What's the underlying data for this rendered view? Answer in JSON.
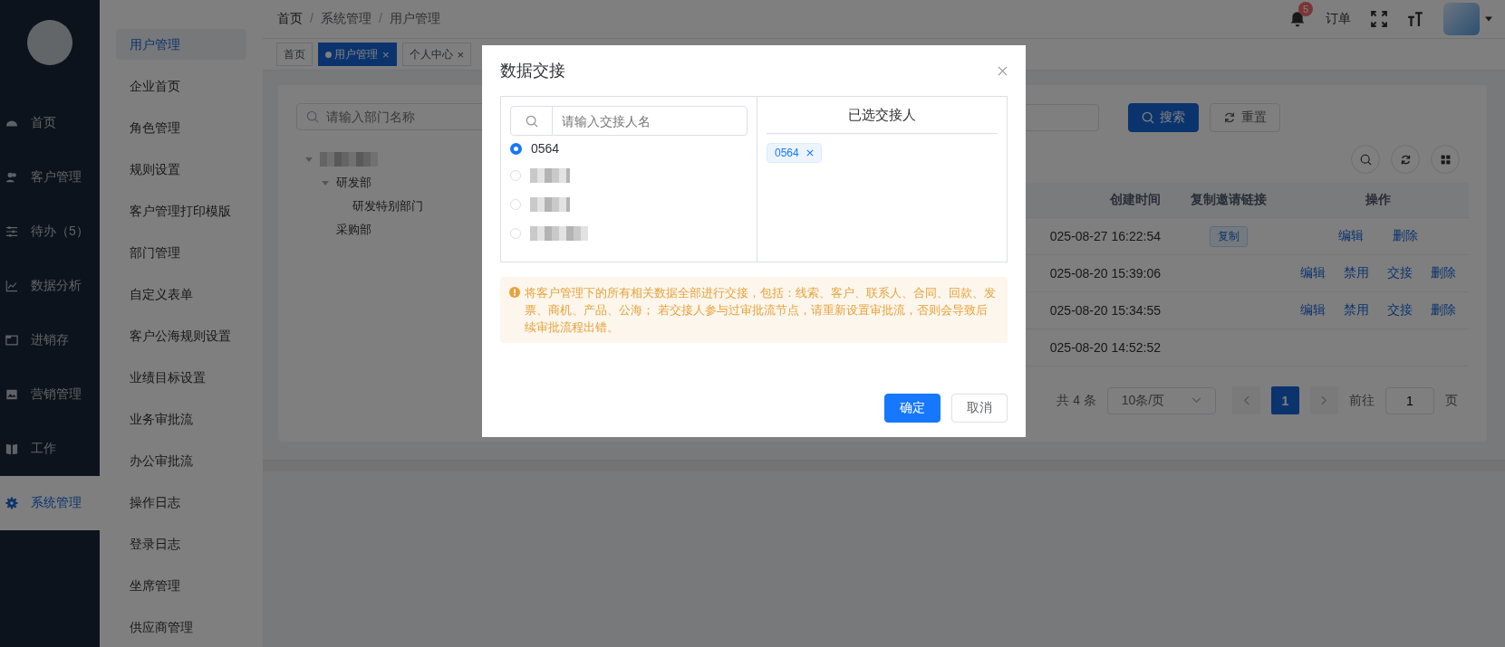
{
  "nav": {
    "items": [
      {
        "label": "首页",
        "selected": false
      },
      {
        "label": "客户管理",
        "selected": false
      },
      {
        "label": "待办（5）",
        "selected": false
      },
      {
        "label": "数据分析",
        "selected": false
      },
      {
        "label": "进销存",
        "selected": false
      },
      {
        "label": "营销管理",
        "selected": false
      },
      {
        "label": "工作",
        "selected": false
      },
      {
        "label": "系统管理",
        "selected": true
      }
    ]
  },
  "submenu": {
    "items": [
      {
        "label": "用户管理",
        "selected": true
      },
      {
        "label": "企业首页",
        "selected": false
      },
      {
        "label": "角色管理",
        "selected": false
      },
      {
        "label": "规则设置",
        "selected": false
      },
      {
        "label": "客户管理打印模版",
        "selected": false
      },
      {
        "label": "部门管理",
        "selected": false
      },
      {
        "label": "自定义表单",
        "selected": false
      },
      {
        "label": "客户公海规则设置",
        "selected": false
      },
      {
        "label": "业绩目标设置",
        "selected": false
      },
      {
        "label": "业务审批流",
        "selected": false
      },
      {
        "label": "办公审批流",
        "selected": false
      },
      {
        "label": "操作日志",
        "selected": false
      },
      {
        "label": "登录日志",
        "selected": false
      },
      {
        "label": "坐席管理",
        "selected": false
      },
      {
        "label": "供应商管理",
        "selected": false
      }
    ]
  },
  "header": {
    "breadcrumb": [
      "首页",
      "系统管理",
      "用户管理"
    ],
    "breadcrumb_separator": "/",
    "notification_count": "5",
    "order_link": "订单"
  },
  "tabs": [
    {
      "label": "首页",
      "selected": false
    },
    {
      "label": "用户管理",
      "selected": true,
      "close": "×"
    },
    {
      "label": "个人中心",
      "selected": false,
      "close": "×"
    }
  ],
  "card": {
    "dept_search": {
      "placeholder": "请输入部门名称"
    },
    "tree": [
      {
        "kind": "redacted",
        "expanded": true,
        "children": [
          {
            "label": "研发部",
            "expanded": true,
            "children": [
              {
                "label": "研发特别部门"
              }
            ]
          },
          {
            "label": "采购部"
          }
        ]
      }
    ],
    "search_button": "搜索",
    "reset_button": "重置",
    "table": {
      "columns": [
        "创建时间",
        "复制邀请链接",
        "操作"
      ],
      "rows": [
        {
          "created": "025-08-27 16:22:54",
          "copy": "复制",
          "actions": [
            "编辑",
            "删除"
          ]
        },
        {
          "created": "025-08-20 15:39:06",
          "actions": [
            "编辑",
            "禁用",
            "交接",
            "删除"
          ]
        },
        {
          "created": "025-08-20 15:34:55",
          "actions": [
            "编辑",
            "禁用",
            "交接",
            "删除"
          ]
        },
        {
          "created": "025-08-20 14:52:52",
          "actions": []
        }
      ]
    },
    "pagination": {
      "total": "共 4 条",
      "page_size": "10条/页",
      "pages": [
        {
          "label": "1",
          "selected": true
        }
      ],
      "goto_label": "前往",
      "goto_value": "1",
      "page_suffix": "页"
    }
  },
  "dialog": {
    "title": "数据交接",
    "search": {
      "placeholder": "请输入交接人名"
    },
    "people": [
      {
        "kind": "name",
        "name": "0564",
        "selected": true
      },
      {
        "kind": "redacted",
        "selected": false
      },
      {
        "kind": "redacted",
        "selected": false
      },
      {
        "kind": "redacted",
        "selected": false
      }
    ],
    "selected_title": "已选交接人",
    "selected_tags": [
      "0564"
    ],
    "warning": "将客户管理下的所有相关数据全部进行交接，包括：线索、客户、联系人、合同、回款、发票、商机、产品、公海； 若交接人参与过审批流节点，请重新设置审批流，否则会导致后续审批流程出错。",
    "confirm_button": "确定",
    "cancel_button": "取消"
  }
}
